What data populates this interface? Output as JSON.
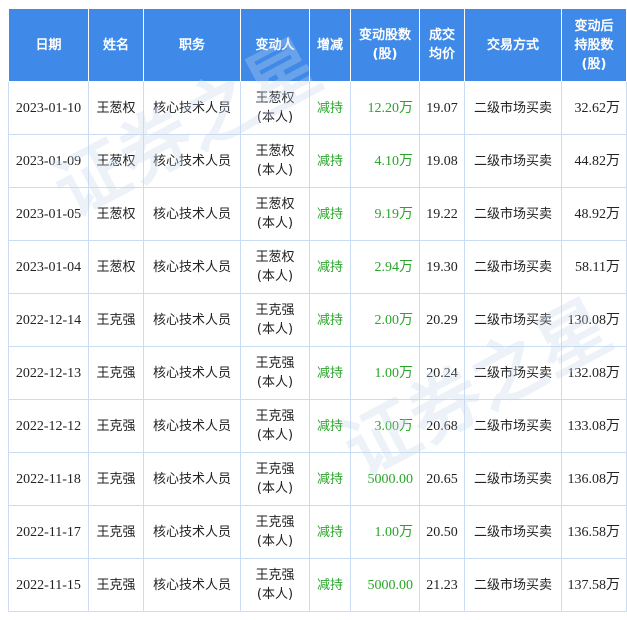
{
  "headers": {
    "date": "日期",
    "name": "姓名",
    "position": "职务",
    "changer": "变动人",
    "direction": "增减",
    "shares_changed": "变动股数\n(股)",
    "avg_price": "成交\n均价",
    "method": "交易方式",
    "shares_after": "变动后\n持股数\n(股)"
  },
  "rows": [
    {
      "date": "2023-01-10",
      "name": "王葱权",
      "position": "核心技术人员",
      "changer": "王葱权\n(本人)",
      "direction": "减持",
      "shares_changed": "12.20万",
      "avg_price": "19.07",
      "method": "二级市场买卖",
      "shares_after": "32.62万"
    },
    {
      "date": "2023-01-09",
      "name": "王葱权",
      "position": "核心技术人员",
      "changer": "王葱权\n(本人)",
      "direction": "减持",
      "shares_changed": "4.10万",
      "avg_price": "19.08",
      "method": "二级市场买卖",
      "shares_after": "44.82万"
    },
    {
      "date": "2023-01-05",
      "name": "王葱权",
      "position": "核心技术人员",
      "changer": "王葱权\n(本人)",
      "direction": "减持",
      "shares_changed": "9.19万",
      "avg_price": "19.22",
      "method": "二级市场买卖",
      "shares_after": "48.92万"
    },
    {
      "date": "2023-01-04",
      "name": "王葱权",
      "position": "核心技术人员",
      "changer": "王葱权\n(本人)",
      "direction": "减持",
      "shares_changed": "2.94万",
      "avg_price": "19.30",
      "method": "二级市场买卖",
      "shares_after": "58.11万"
    },
    {
      "date": "2022-12-14",
      "name": "王克强",
      "position": "核心技术人员",
      "changer": "王克强\n(本人)",
      "direction": "减持",
      "shares_changed": "2.00万",
      "avg_price": "20.29",
      "method": "二级市场买卖",
      "shares_after": "130.08万"
    },
    {
      "date": "2022-12-13",
      "name": "王克强",
      "position": "核心技术人员",
      "changer": "王克强\n(本人)",
      "direction": "减持",
      "shares_changed": "1.00万",
      "avg_price": "20.24",
      "method": "二级市场买卖",
      "shares_after": "132.08万"
    },
    {
      "date": "2022-12-12",
      "name": "王克强",
      "position": "核心技术人员",
      "changer": "王克强\n(本人)",
      "direction": "减持",
      "shares_changed": "3.00万",
      "avg_price": "20.68",
      "method": "二级市场买卖",
      "shares_after": "133.08万"
    },
    {
      "date": "2022-11-18",
      "name": "王克强",
      "position": "核心技术人员",
      "changer": "王克强\n(本人)",
      "direction": "减持",
      "shares_changed": "5000.00",
      "avg_price": "20.65",
      "method": "二级市场买卖",
      "shares_after": "136.08万"
    },
    {
      "date": "2022-11-17",
      "name": "王克强",
      "position": "核心技术人员",
      "changer": "王克强\n(本人)",
      "direction": "减持",
      "shares_changed": "1.00万",
      "avg_price": "20.50",
      "method": "二级市场买卖",
      "shares_after": "136.58万"
    },
    {
      "date": "2022-11-15",
      "name": "王克强",
      "position": "核心技术人员",
      "changer": "王克强\n(本人)",
      "direction": "减持",
      "shares_changed": "5000.00",
      "avg_price": "21.23",
      "method": "二级市场买卖",
      "shares_after": "137.58万"
    }
  ],
  "watermark": "证券之星",
  "colors": {
    "header_bg": "#3f8ae8",
    "reduce_text": "#2aa52a",
    "border": "#c9dcf3"
  }
}
